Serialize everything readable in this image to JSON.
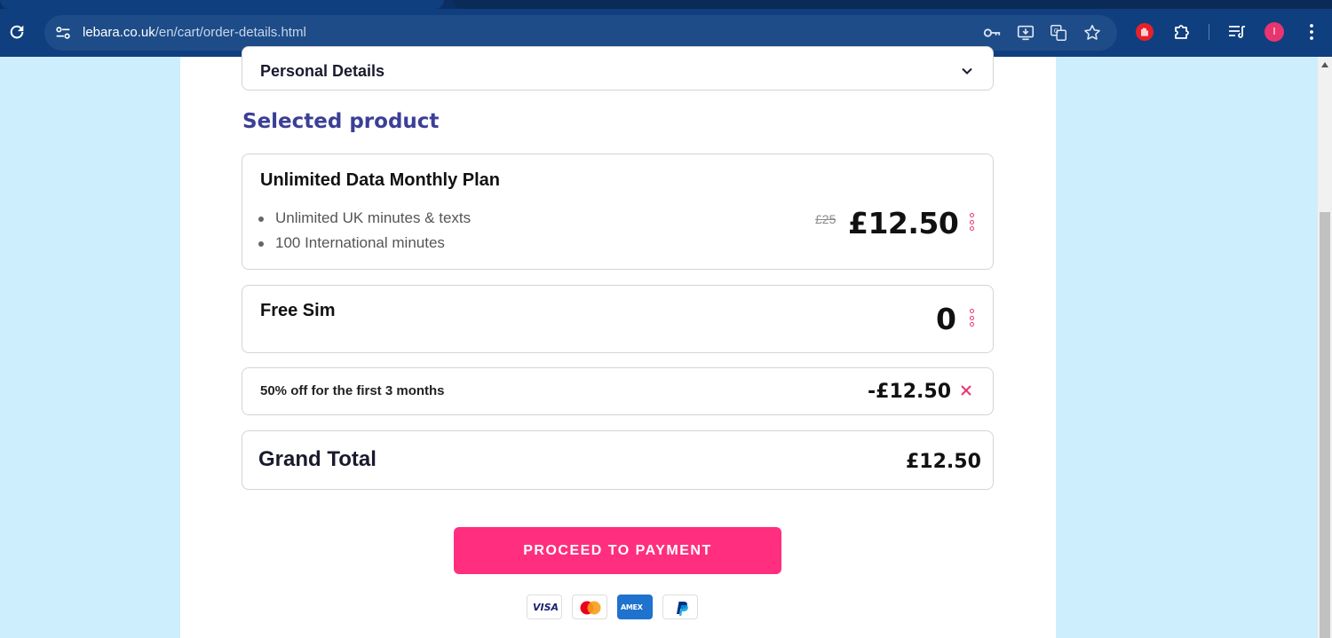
{
  "browser": {
    "url_host": "lebara.co.uk",
    "url_path": "/en/cart/order-details.html",
    "profile_initial": "I",
    "icons": [
      "reload-icon",
      "site-settings-icon",
      "password-key-icon",
      "install-app-icon",
      "translate-icon",
      "bookmark-star-icon",
      "extension-stop-icon",
      "extensions-puzzle-icon",
      "reading-list-icon",
      "profile-avatar",
      "more-menu-icon"
    ]
  },
  "personal_details": {
    "title": "Personal Details"
  },
  "section": {
    "title": "Selected product"
  },
  "plan": {
    "title": "Unlimited Data Monthly Plan",
    "features": [
      "Unlimited UK minutes & texts",
      "100 International minutes"
    ],
    "old_price": "£25",
    "price": "£12.50"
  },
  "sim": {
    "title": "Free Sim",
    "price": "0"
  },
  "discount": {
    "label": "50% off for the first 3 months",
    "price": "-£12.50"
  },
  "total": {
    "label": "Grand Total",
    "price": "£12.50"
  },
  "payment": {
    "button_label": "PROCEED TO PAYMENT",
    "methods": [
      "VISA",
      "Mastercard",
      "AMEX",
      "PayPal"
    ]
  },
  "colors": {
    "accent_pink": "#ff2e7e",
    "heading_blue": "#3b3f96",
    "page_bg": "#cdeefc",
    "chrome_bg": "#0f3f7f"
  }
}
